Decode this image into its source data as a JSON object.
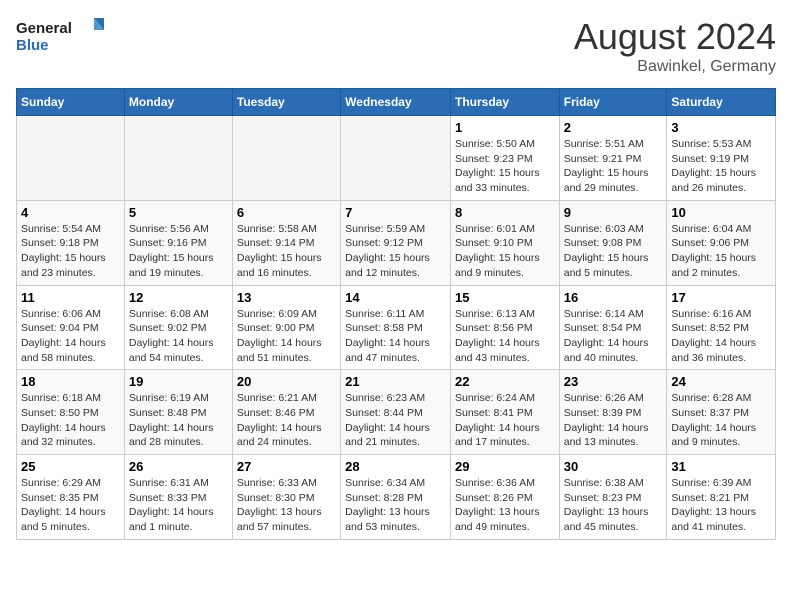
{
  "logo": {
    "line1": "General",
    "line2": "Blue"
  },
  "title": "August 2024",
  "location": "Bawinkel, Germany",
  "weekdays": [
    "Sunday",
    "Monday",
    "Tuesday",
    "Wednesday",
    "Thursday",
    "Friday",
    "Saturday"
  ],
  "weeks": [
    [
      {
        "day": "",
        "empty": true
      },
      {
        "day": "",
        "empty": true
      },
      {
        "day": "",
        "empty": true
      },
      {
        "day": "",
        "empty": true
      },
      {
        "day": "1",
        "sunrise": "5:50 AM",
        "sunset": "9:23 PM",
        "daylight": "15 hours and 33 minutes."
      },
      {
        "day": "2",
        "sunrise": "5:51 AM",
        "sunset": "9:21 PM",
        "daylight": "15 hours and 29 minutes."
      },
      {
        "day": "3",
        "sunrise": "5:53 AM",
        "sunset": "9:19 PM",
        "daylight": "15 hours and 26 minutes."
      }
    ],
    [
      {
        "day": "4",
        "sunrise": "5:54 AM",
        "sunset": "9:18 PM",
        "daylight": "15 hours and 23 minutes."
      },
      {
        "day": "5",
        "sunrise": "5:56 AM",
        "sunset": "9:16 PM",
        "daylight": "15 hours and 19 minutes."
      },
      {
        "day": "6",
        "sunrise": "5:58 AM",
        "sunset": "9:14 PM",
        "daylight": "15 hours and 16 minutes."
      },
      {
        "day": "7",
        "sunrise": "5:59 AM",
        "sunset": "9:12 PM",
        "daylight": "15 hours and 12 minutes."
      },
      {
        "day": "8",
        "sunrise": "6:01 AM",
        "sunset": "9:10 PM",
        "daylight": "15 hours and 9 minutes."
      },
      {
        "day": "9",
        "sunrise": "6:03 AM",
        "sunset": "9:08 PM",
        "daylight": "15 hours and 5 minutes."
      },
      {
        "day": "10",
        "sunrise": "6:04 AM",
        "sunset": "9:06 PM",
        "daylight": "15 hours and 2 minutes."
      }
    ],
    [
      {
        "day": "11",
        "sunrise": "6:06 AM",
        "sunset": "9:04 PM",
        "daylight": "14 hours and 58 minutes."
      },
      {
        "day": "12",
        "sunrise": "6:08 AM",
        "sunset": "9:02 PM",
        "daylight": "14 hours and 54 minutes."
      },
      {
        "day": "13",
        "sunrise": "6:09 AM",
        "sunset": "9:00 PM",
        "daylight": "14 hours and 51 minutes."
      },
      {
        "day": "14",
        "sunrise": "6:11 AM",
        "sunset": "8:58 PM",
        "daylight": "14 hours and 47 minutes."
      },
      {
        "day": "15",
        "sunrise": "6:13 AM",
        "sunset": "8:56 PM",
        "daylight": "14 hours and 43 minutes."
      },
      {
        "day": "16",
        "sunrise": "6:14 AM",
        "sunset": "8:54 PM",
        "daylight": "14 hours and 40 minutes."
      },
      {
        "day": "17",
        "sunrise": "6:16 AM",
        "sunset": "8:52 PM",
        "daylight": "14 hours and 36 minutes."
      }
    ],
    [
      {
        "day": "18",
        "sunrise": "6:18 AM",
        "sunset": "8:50 PM",
        "daylight": "14 hours and 32 minutes."
      },
      {
        "day": "19",
        "sunrise": "6:19 AM",
        "sunset": "8:48 PM",
        "daylight": "14 hours and 28 minutes."
      },
      {
        "day": "20",
        "sunrise": "6:21 AM",
        "sunset": "8:46 PM",
        "daylight": "14 hours and 24 minutes."
      },
      {
        "day": "21",
        "sunrise": "6:23 AM",
        "sunset": "8:44 PM",
        "daylight": "14 hours and 21 minutes."
      },
      {
        "day": "22",
        "sunrise": "6:24 AM",
        "sunset": "8:41 PM",
        "daylight": "14 hours and 17 minutes."
      },
      {
        "day": "23",
        "sunrise": "6:26 AM",
        "sunset": "8:39 PM",
        "daylight": "14 hours and 13 minutes."
      },
      {
        "day": "24",
        "sunrise": "6:28 AM",
        "sunset": "8:37 PM",
        "daylight": "14 hours and 9 minutes."
      }
    ],
    [
      {
        "day": "25",
        "sunrise": "6:29 AM",
        "sunset": "8:35 PM",
        "daylight": "14 hours and 5 minutes."
      },
      {
        "day": "26",
        "sunrise": "6:31 AM",
        "sunset": "8:33 PM",
        "daylight": "14 hours and 1 minute."
      },
      {
        "day": "27",
        "sunrise": "6:33 AM",
        "sunset": "8:30 PM",
        "daylight": "13 hours and 57 minutes."
      },
      {
        "day": "28",
        "sunrise": "6:34 AM",
        "sunset": "8:28 PM",
        "daylight": "13 hours and 53 minutes."
      },
      {
        "day": "29",
        "sunrise": "6:36 AM",
        "sunset": "8:26 PM",
        "daylight": "13 hours and 49 minutes."
      },
      {
        "day": "30",
        "sunrise": "6:38 AM",
        "sunset": "8:23 PM",
        "daylight": "13 hours and 45 minutes."
      },
      {
        "day": "31",
        "sunrise": "6:39 AM",
        "sunset": "8:21 PM",
        "daylight": "13 hours and 41 minutes."
      }
    ]
  ]
}
